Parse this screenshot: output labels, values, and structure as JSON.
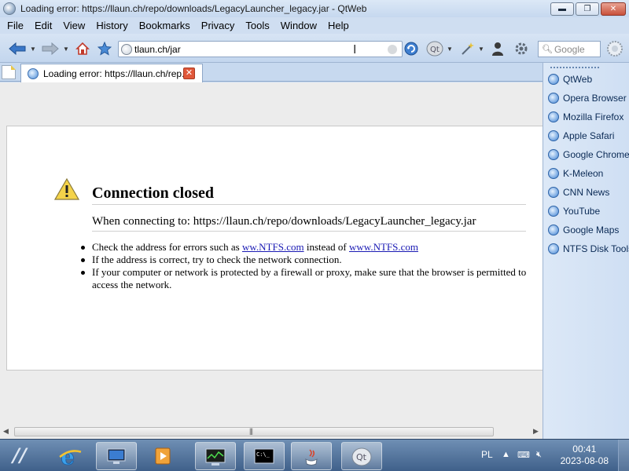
{
  "window": {
    "title": "Loading error: https://llaun.ch/repo/downloads/LegacyLauncher_legacy.jar - QtWeb",
    "controls": {
      "minimize": "▬",
      "maximize": "❐",
      "close": "✕"
    }
  },
  "menubar": {
    "items": [
      "File",
      "Edit",
      "View",
      "History",
      "Bookmarks",
      "Privacy",
      "Tools",
      "Window",
      "Help"
    ]
  },
  "toolbar": {
    "address_value": "tlaun.ch/jar",
    "search_placeholder": "Google",
    "icons": [
      "back-icon",
      "forward-icon",
      "home-icon",
      "bookmark-star-icon",
      "refresh-icon",
      "qt-menu-icon",
      "magic-wand-icon",
      "user-agent-icon",
      "settings-icon",
      "search-icon",
      "compass-icon"
    ]
  },
  "tabs": [
    {
      "label": "Loading error: https://llaun.ch/rep...",
      "close": "✕"
    }
  ],
  "error_page": {
    "title": "Connection closed",
    "subtitle": "When connecting to: https://llaun.ch/repo/downloads/LegacyLauncher_legacy.jar",
    "bullet1_prefix": "Check the address for errors such as ",
    "bullet1_link1_pre": "ww",
    "bullet1_link1": ".NTFS.com",
    "bullet1_middle": " instead of ",
    "bullet1_link2_pre": "www",
    "bullet1_link2": ".NTFS.com",
    "bullet2": "If the address is correct, try to check the network connection.",
    "bullet3": "If your computer or network is protected by a firewall or proxy, make sure that the browser is permitted to access the network."
  },
  "scrollbar": {
    "grip": "|||"
  },
  "sidebar": {
    "items": [
      "QtWeb",
      "Opera Browser",
      "Mozilla Firefox",
      "Apple Safari",
      "Google Chrome",
      "K-Meleon",
      "CNN News",
      "YouTube",
      "Google Maps",
      "NTFS Disk Tools"
    ]
  },
  "taskbar": {
    "apps": [
      "internet-explorer-icon",
      "computer-icon",
      "media-player-icon",
      "task-manager-icon",
      "command-prompt-icon",
      "java-icon",
      "qtweb-icon"
    ],
    "language": "PL",
    "time": "00:41",
    "date": "2023-08-08"
  }
}
